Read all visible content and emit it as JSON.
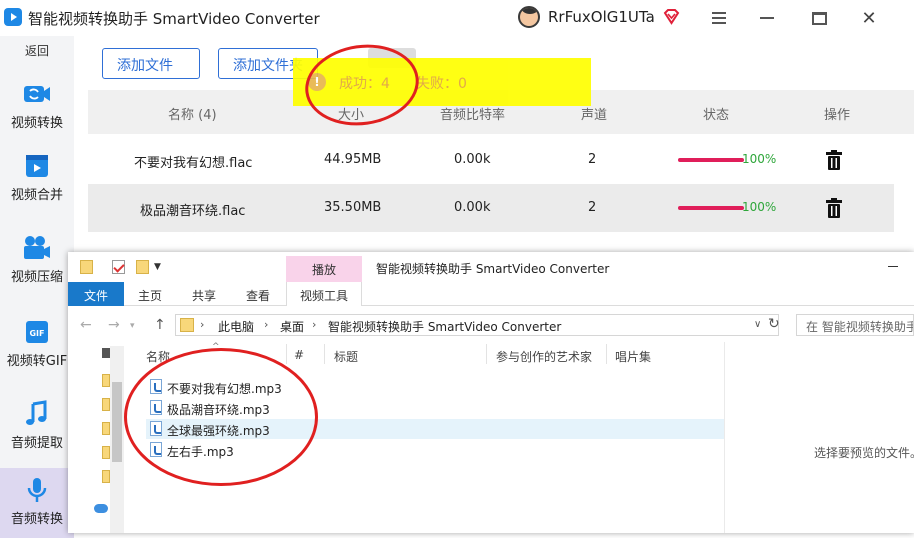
{
  "app": {
    "title": "智能视频转换助手 SmartVideo Converter",
    "username": "RrFuxOlG1UTa",
    "icons": [
      "app-logo-icon",
      "avatar",
      "vip-diamond-icon",
      "menu-icon",
      "minimize-icon",
      "maximize-icon",
      "close-icon"
    ]
  },
  "sidebar": {
    "back": "返回",
    "items": [
      {
        "label": "视频转换",
        "icon": "video-convert-icon"
      },
      {
        "label": "视频合并",
        "icon": "video-merge-icon"
      },
      {
        "label": "视频压缩",
        "icon": "video-compress-icon"
      },
      {
        "label": "视频转GIF",
        "icon": "gif-icon"
      },
      {
        "label": "音频提取",
        "icon": "music-note-icon"
      },
      {
        "label": "音频转换",
        "icon": "microphone-icon",
        "active": true
      }
    ]
  },
  "toolbar": {
    "add_file": "添加文件",
    "add_folder": "添加文件夹"
  },
  "table": {
    "headers": {
      "name": "名称 (4)",
      "size": "大小",
      "bitrate": "音频比特率",
      "channels": "声道",
      "status": "状态",
      "actions": "操作"
    },
    "rows": [
      {
        "name": "不要对我有幻想.flac",
        "size": "44.95MB",
        "bitrate": "0.00k",
        "channels": "2",
        "progress": "100%"
      },
      {
        "name": "极品潮音环绕.flac",
        "size": "35.50MB",
        "bitrate": "0.00k",
        "channels": "2",
        "progress": "100%"
      }
    ]
  },
  "toast": {
    "success": "成功：4",
    "fail": "失败：0",
    "icon": "!"
  },
  "explorer": {
    "context_tab": "播放",
    "title": "智能视频转换助手 SmartVideo Converter",
    "ribbon_tabs": {
      "file": "文件",
      "home": "主页",
      "share": "共享",
      "view": "查看",
      "video_tools": "视频工具"
    },
    "breadcrumb": [
      "此电脑",
      "桌面",
      "智能视频转换助手 SmartVideo Converter"
    ],
    "search_placeholder": "在 智能视频转换助手",
    "columns": {
      "name": "名称",
      "number": "#",
      "title": "标题",
      "artist": "参与创作的艺术家",
      "album": "唱片集"
    },
    "files": [
      "不要对我有幻想.mp3",
      "极品潮音环绕.mp3",
      "全球最强环绕.mp3",
      "左右手.mp3"
    ],
    "preview_hint": "选择要预览的文件。"
  },
  "colors": {
    "accent_blue": "#2f6fd6",
    "progress_red": "#e01e5a",
    "progress_text_green": "#2ea63a",
    "toast_yellow": "#ffff00",
    "annotation_red": "#e02020",
    "ribbon_file_blue": "#1979ca"
  }
}
